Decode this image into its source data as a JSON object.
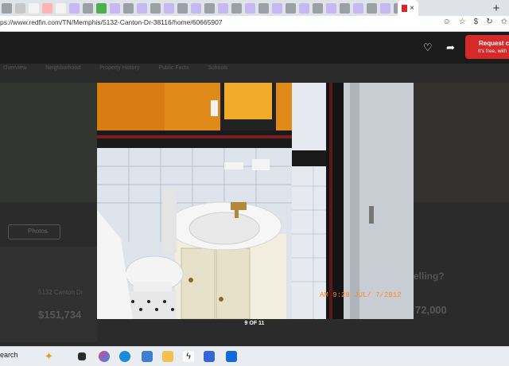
{
  "browser": {
    "active_tab_label": "×",
    "new_tab_label": "+",
    "url": "ps://www.redfin.com/TN/Memphis/5132-Canton-Dr-38116/home/60665907"
  },
  "header": {
    "request_cta_line1": "Request c",
    "request_cta_line2": "It's free, with"
  },
  "background_page": {
    "nav_items": [
      "Overview",
      "Neighborhood",
      "Property History",
      "Public Facts",
      "Schools"
    ],
    "photos_button": "Photos",
    "address_snippet": "5132 Canton Dr",
    "price": "$151,734",
    "selling_snippet": "elling?",
    "selling_price": "72,000"
  },
  "viewer": {
    "counter": "9 OF 11",
    "photo_timestamp": "AM 9:28 JUL/ 7/2012"
  },
  "taskbar": {
    "search_label": "earch"
  },
  "colors": {
    "cta_red": "#d42a2a",
    "header_bg": "#1b1b1b",
    "wall_orange": "#e08a1a"
  }
}
